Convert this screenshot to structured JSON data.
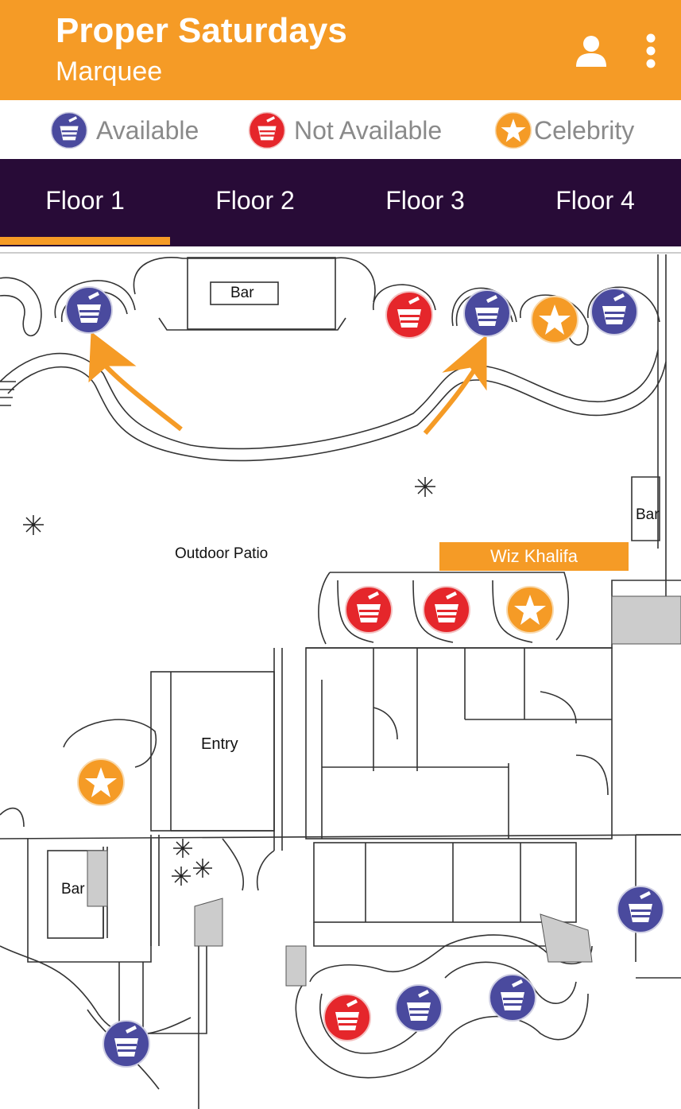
{
  "header": {
    "title": "Proper Saturdays",
    "subtitle": "Marquee"
  },
  "legend": {
    "available": "Available",
    "not_available": "Not Available",
    "celebrity": "Celebrity"
  },
  "tabs": [
    {
      "label": "Floor 1",
      "selected": true
    },
    {
      "label": "Floor 2",
      "selected": false
    },
    {
      "label": "Floor 3",
      "selected": false
    },
    {
      "label": "Floor 4",
      "selected": false
    }
  ],
  "map": {
    "labels": {
      "bar_top": "Bar",
      "bar_right": "Bar",
      "bar_left": "Bar",
      "outdoor_patio": "Outdoor Patio",
      "entry": "Entry"
    },
    "celebrity_callout": "Wiz Khalifa"
  },
  "colors": {
    "brand_orange": "#f59b26",
    "tab_bar": "#280b37",
    "available": "#4a4a9e",
    "not_available": "#e5262b",
    "celebrity": "#f59b26"
  },
  "icons": {
    "available": "ice-bucket-icon",
    "not_available": "ice-bucket-icon",
    "celebrity": "star-icon"
  }
}
